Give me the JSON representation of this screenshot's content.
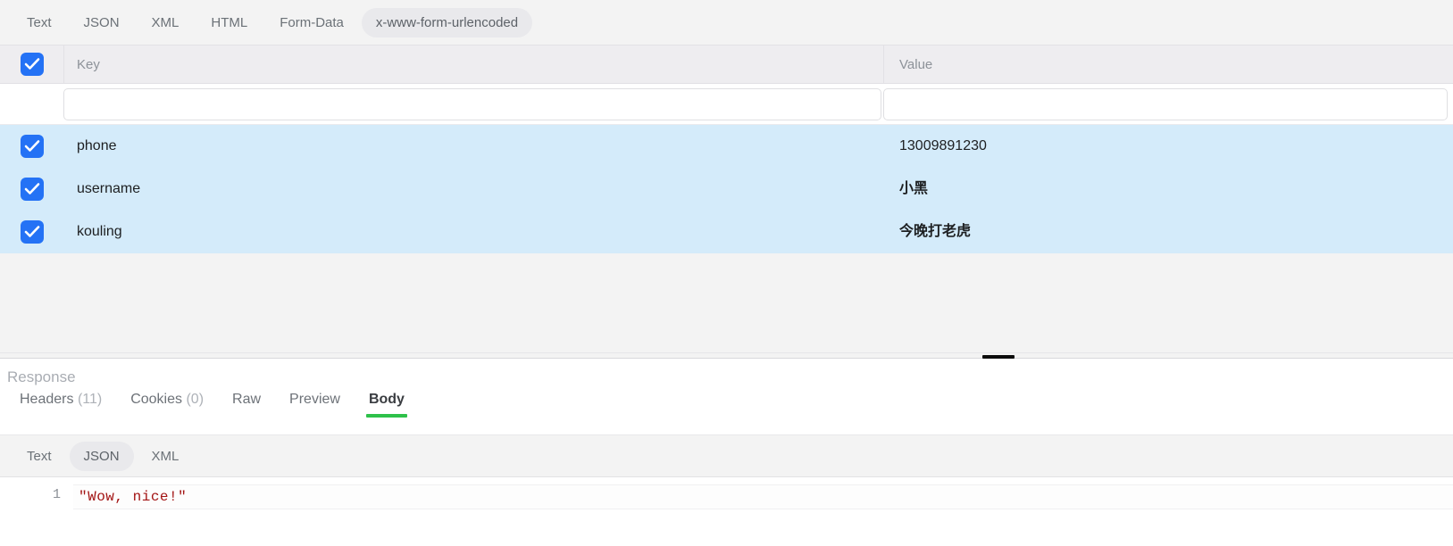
{
  "request_body": {
    "type_tabs": [
      {
        "label": "Text",
        "selected": false
      },
      {
        "label": "JSON",
        "selected": false
      },
      {
        "label": "XML",
        "selected": false
      },
      {
        "label": "HTML",
        "selected": false
      },
      {
        "label": "Form-Data",
        "selected": false
      },
      {
        "label": "x-www-form-urlencoded",
        "selected": true
      }
    ],
    "table": {
      "select_all_checked": true,
      "headers": {
        "key": "Key",
        "value": "Value"
      },
      "new_row": {
        "key_value": "",
        "key_placeholder": "",
        "value_value": "",
        "value_placeholder": ""
      },
      "rows": [
        {
          "checked": true,
          "key": "phone",
          "value": "13009891230",
          "cjk": false
        },
        {
          "checked": true,
          "key": "username",
          "value": "小黑",
          "cjk": true
        },
        {
          "checked": true,
          "key": "kouling",
          "value": "今晚打老虎",
          "cjk": true
        }
      ]
    }
  },
  "response": {
    "title": "Response",
    "tabs": [
      {
        "label": "Headers",
        "count": "(11)",
        "active": false
      },
      {
        "label": "Cookies",
        "count": "(0)",
        "active": false
      },
      {
        "label": "Raw",
        "count": "",
        "active": false
      },
      {
        "label": "Preview",
        "count": "",
        "active": false
      },
      {
        "label": "Body",
        "count": "",
        "active": true
      }
    ],
    "format_tabs": [
      {
        "label": "Text",
        "selected": false
      },
      {
        "label": "JSON",
        "selected": true
      },
      {
        "label": "XML",
        "selected": false
      }
    ],
    "body": {
      "line_number": "1",
      "content": "\"Wow, nice!\""
    }
  },
  "colors": {
    "accent_blue": "#2472f5",
    "row_highlight": "#d4ebfa",
    "active_tab_green": "#2ec14a",
    "string_red": "#a31515"
  }
}
